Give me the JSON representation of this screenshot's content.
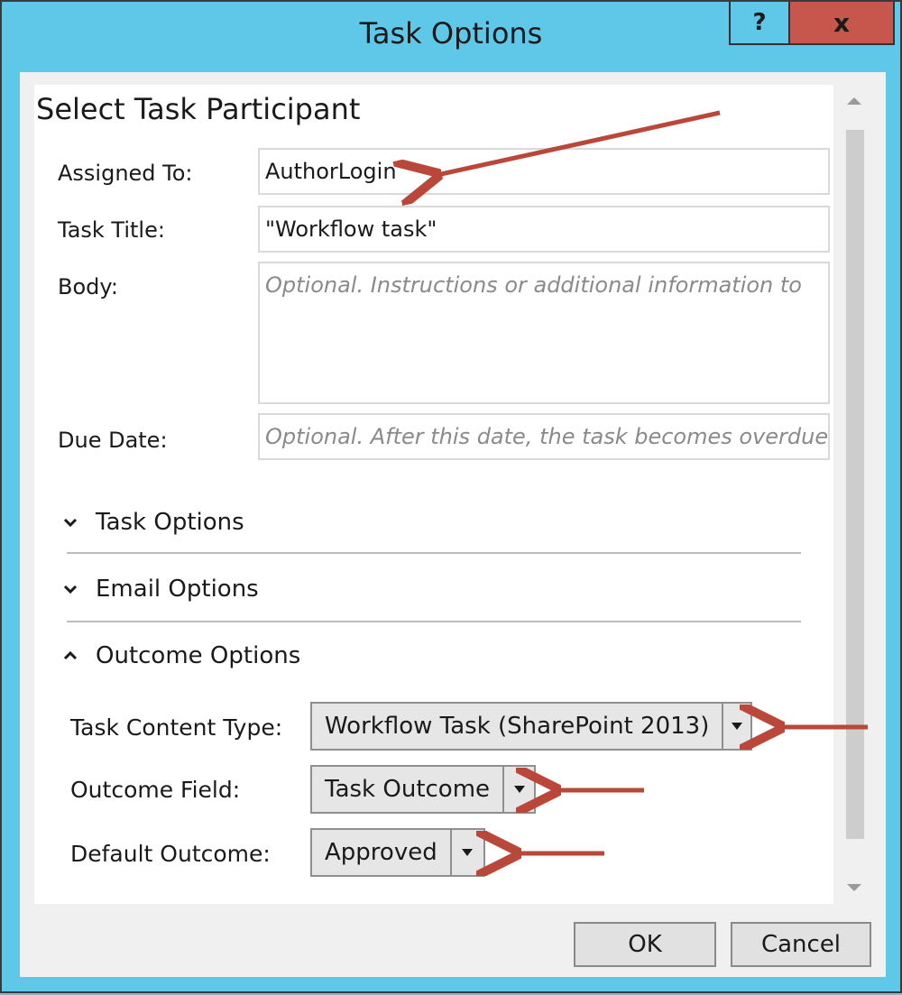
{
  "window": {
    "title": "Task Options",
    "help_label": "?",
    "close_label": "x"
  },
  "section": {
    "title": "Select Task Participant"
  },
  "fields": {
    "assigned_to": {
      "label": "Assigned To:",
      "value": "AuthorLogin"
    },
    "task_title": {
      "label": "Task Title:",
      "value": "\"Workflow task\""
    },
    "body": {
      "label": "Body:",
      "placeholder": "Optional. Instructions or additional information to"
    },
    "due_date": {
      "label": "Due Date:",
      "placeholder": "Optional. After this date, the task becomes overdue"
    }
  },
  "expanders": {
    "task_options": {
      "label": "Task Options",
      "state": "collapsed"
    },
    "email_options": {
      "label": "Email Options",
      "state": "collapsed"
    },
    "outcome_options": {
      "label": "Outcome Options",
      "state": "expanded"
    }
  },
  "outcome": {
    "content_type": {
      "label": "Task Content Type:",
      "value": "Workflow Task (SharePoint 2013)"
    },
    "outcome_field": {
      "label": "Outcome Field:",
      "value": "Task Outcome"
    },
    "default_outcome": {
      "label": "Default Outcome:",
      "value": "Approved"
    }
  },
  "buttons": {
    "ok": "OK",
    "cancel": "Cancel"
  },
  "icons": {
    "chevron_collapsed": "chevron-down-icon",
    "chevron_expanded": "chevron-up-icon",
    "dropdown": "caret-down-icon",
    "annotation": "red-arrow-icon"
  },
  "colors": {
    "titlebar": "#5fc7e8",
    "close_button": "#c7574c",
    "annotation_arrow": "#b9473a"
  }
}
